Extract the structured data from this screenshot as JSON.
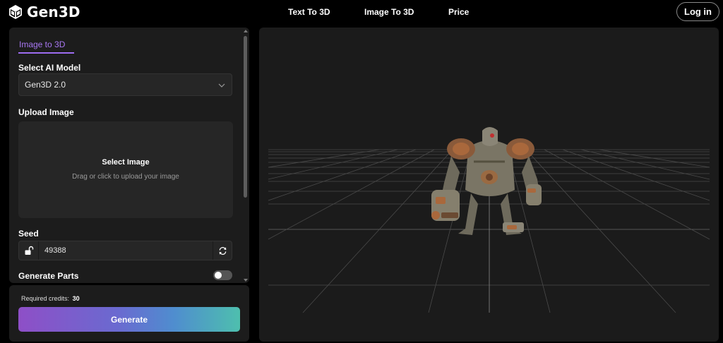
{
  "app": {
    "name": "Gen3D"
  },
  "nav": {
    "items": [
      "Text To 3D",
      "Image To 3D",
      "Price"
    ],
    "login_label": "Log in"
  },
  "panel": {
    "tab_label": "Image to 3D",
    "model_label": "Select AI Model",
    "model_value": "Gen3D 2.0",
    "upload_label": "Upload Image",
    "upload_title": "Select Image",
    "upload_hint": "Drag or click to upload your image",
    "seed_label": "Seed",
    "seed_value": "49388",
    "generate_parts_label": "Generate Parts",
    "generate_parts_enabled": false
  },
  "generate": {
    "credits_label": "Required credits:",
    "credits_value": "30",
    "button_label": "Generate"
  },
  "colors": {
    "accent": "#9d6cf0",
    "panel_bg": "#1c1c1c",
    "viewport_bg": "#1b1b1b"
  }
}
